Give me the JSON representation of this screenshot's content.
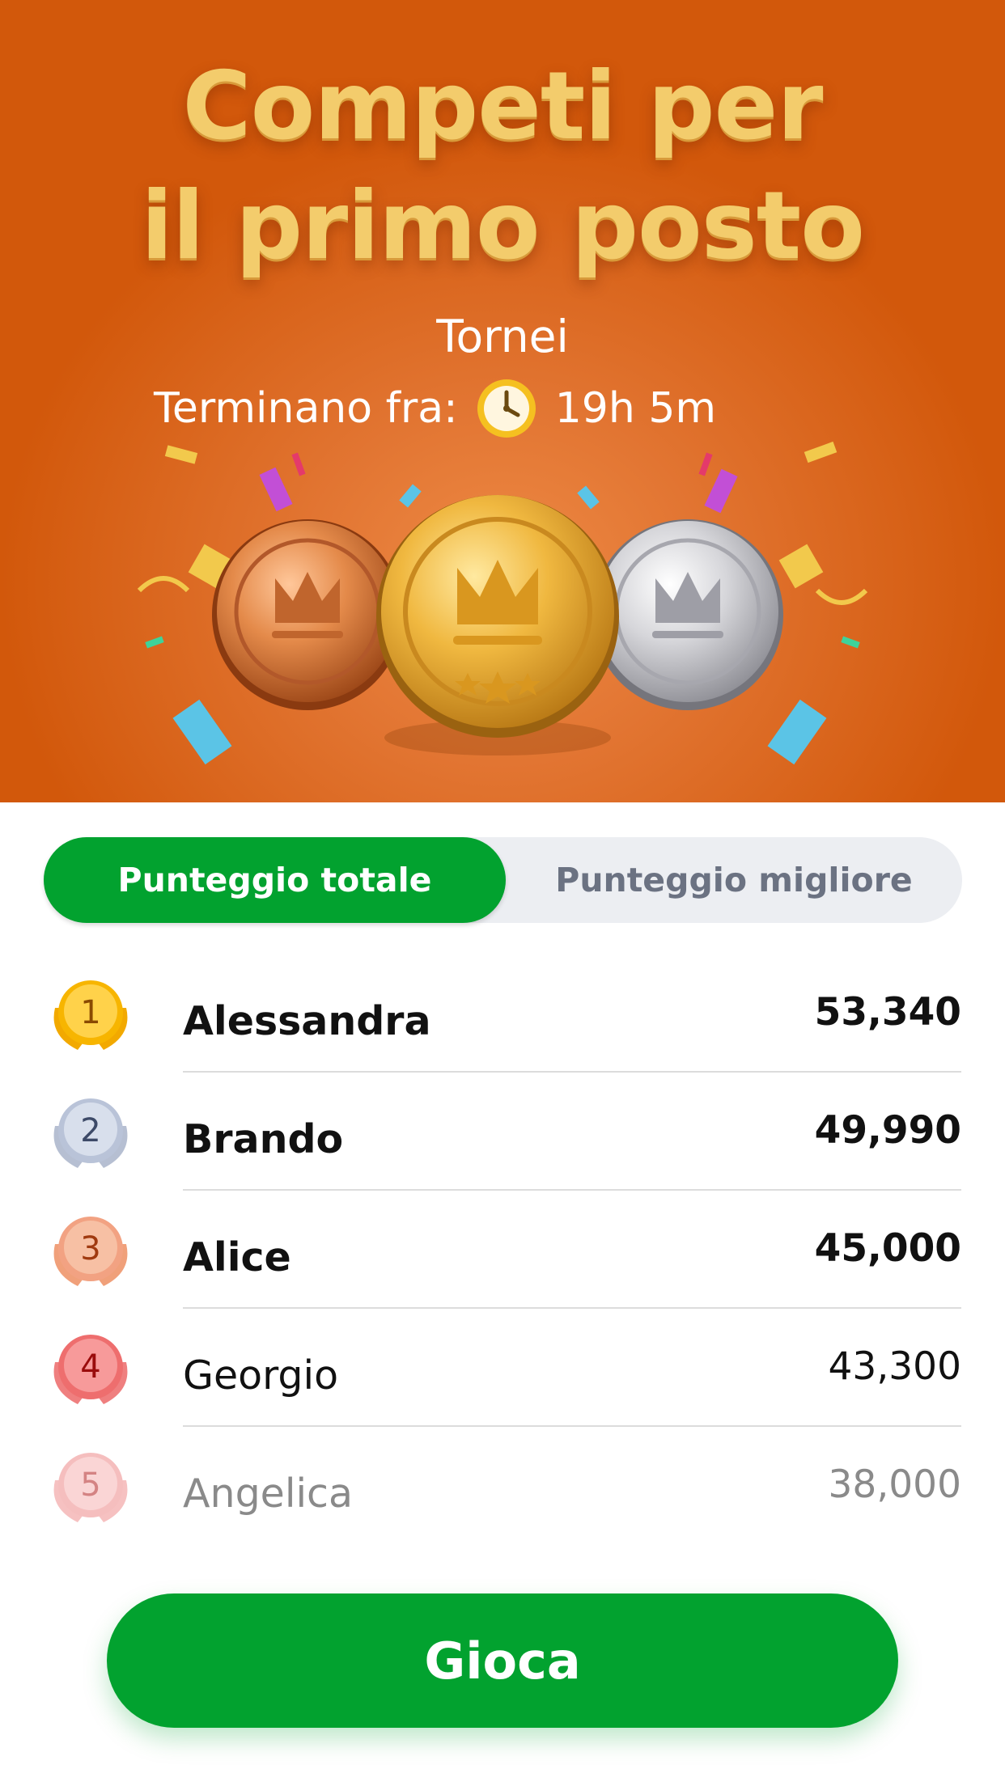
{
  "hero": {
    "title_line1": "Competi per",
    "title_line2": "il primo posto",
    "subtitle": "Tornei",
    "countdown_label": "Terminano fra:",
    "countdown_value": "19h 5m",
    "countdown_icon": "clock-icon",
    "background_color": "#d2580b",
    "title_color": "#f3cc6c"
  },
  "tabs": [
    {
      "label": "Punteggio totale",
      "active": true
    },
    {
      "label": "Punteggio migliore",
      "active": false
    }
  ],
  "leaderboard": [
    {
      "rank": "1",
      "name": "Alessandra",
      "score": "53,340"
    },
    {
      "rank": "2",
      "name": "Brando",
      "score": "49,990"
    },
    {
      "rank": "3",
      "name": "Alice",
      "score": "45,000"
    },
    {
      "rank": "4",
      "name": "Georgio",
      "score": "43,300"
    },
    {
      "rank": "5",
      "name": "Angelica",
      "score": "38,000"
    }
  ],
  "play_button": {
    "label": "Gioca"
  },
  "colors": {
    "accent": "#02a22f",
    "tab_inactive_text": "#6b7282",
    "tab_track": "#eceef2"
  }
}
